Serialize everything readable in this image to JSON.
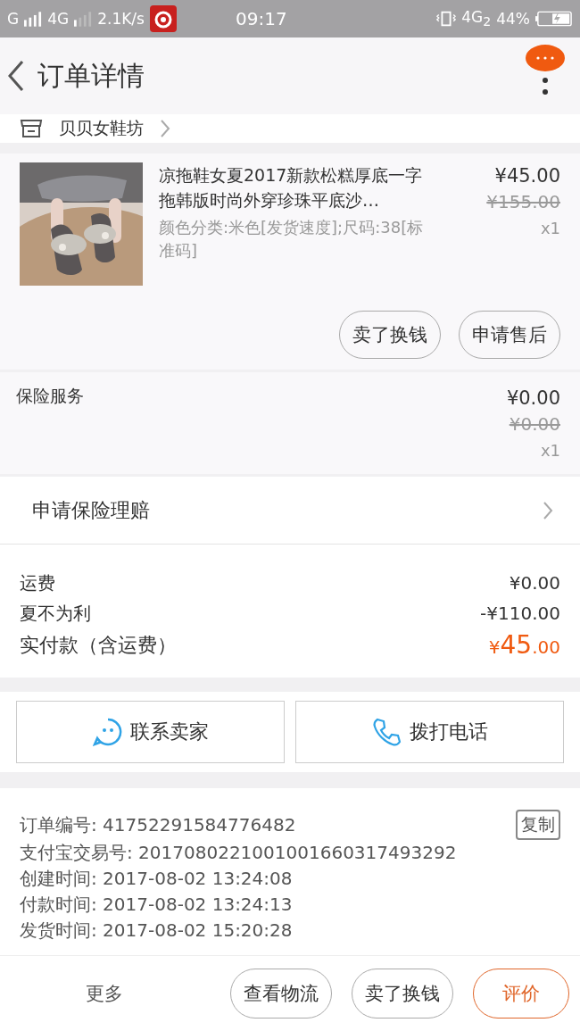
{
  "status_bar": {
    "signal1": "G",
    "signal2": "4G",
    "speed": "2.1K/s",
    "time": "09:17",
    "network": "4G$_{2}$",
    "battery": "44%"
  },
  "header": {
    "title": "订单详情"
  },
  "shop": {
    "name": "贝贝女鞋坊"
  },
  "product": {
    "title": "凉拖鞋女夏2017新款松糕厚底一字拖韩版时尚外穿珍珠平底沙…",
    "sku": "颜色分类:米色[发货速度];尺码:38[标准码]",
    "price": "¥45.00",
    "original_price": "¥155.00",
    "quantity": "x1",
    "buttons": [
      "卖了换钱",
      "申请售后"
    ]
  },
  "insurance": {
    "name": "保险服务",
    "price": "¥0.00",
    "original_price": "¥0.00",
    "quantity": "x1"
  },
  "claim": {
    "label": "申请保险理赔"
  },
  "costs": [
    {
      "label": "运费",
      "value": "¥0.00"
    },
    {
      "label": "夏不为利",
      "value": "-¥110.00"
    }
  ],
  "total": {
    "label": "实付款（含运费）",
    "symbol": "¥",
    "integer": "45",
    "decimal": ".00"
  },
  "contact_buttons": [
    {
      "kind": "chat",
      "label": "联系卖家"
    },
    {
      "kind": "phone",
      "label": "拨打电话"
    }
  ],
  "order_info": [
    {
      "label": "订单编号:",
      "value": "41752291584776482",
      "action": "复制"
    },
    {
      "label": "支付宝交易号:",
      "value": "2017080221001001660317493292"
    },
    {
      "label": "创建时间:",
      "value": "2017-08-02 13:24:08"
    },
    {
      "label": "付款时间:",
      "value": "2017-08-02 13:24:13"
    },
    {
      "label": "发货时间:",
      "value": "2017-08-02 15:20:28"
    }
  ],
  "bottom_bar": {
    "more": "更多",
    "buttons": [
      {
        "label": "查看物流",
        "primary": false
      },
      {
        "label": "卖了换钱",
        "primary": false
      },
      {
        "label": "评价",
        "primary": true
      }
    ]
  }
}
